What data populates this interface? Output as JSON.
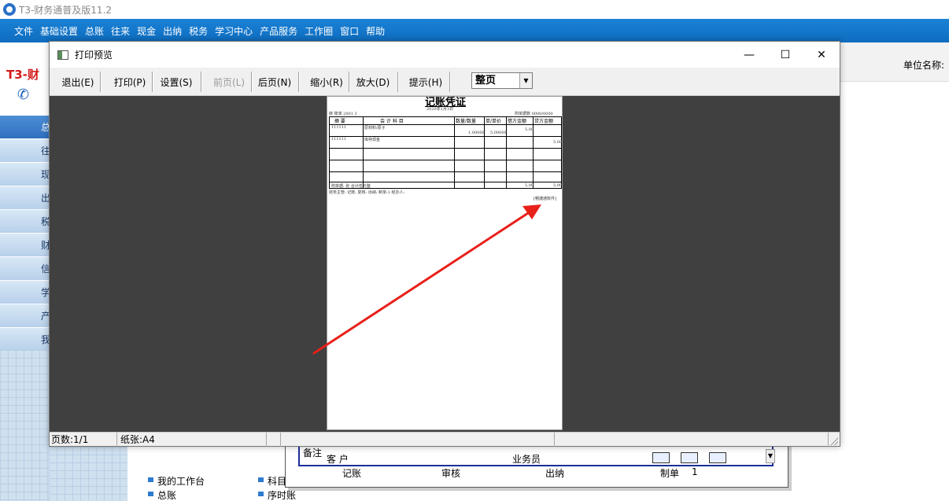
{
  "app": {
    "title": "T3-财务通普及版11.2",
    "brand": "T3-财",
    "menu": [
      "文件",
      "基础设置",
      "总账",
      "往来",
      "现金",
      "出纳",
      "税务",
      "学习中心",
      "产品服务",
      "工作圈",
      "窗口",
      "帮助"
    ],
    "left_nav": [
      "总",
      "往",
      "现",
      "出",
      "税",
      "财",
      "信",
      "学",
      "产",
      "我"
    ],
    "unit_label": "单位名称:",
    "bottom_links": [
      "我的工作台",
      "科目",
      "总账",
      "序时账"
    ]
  },
  "voucher_bg": {
    "labels": [
      "备注",
      "客  户",
      "业务员",
      "记账",
      "审核",
      "出纳",
      "制单",
      "1"
    ]
  },
  "dialog": {
    "title": "打印预览",
    "toolbar": {
      "exit": "退出(E)",
      "print": "打印(P)",
      "settings": "设置(S)",
      "prev": "前页(L)",
      "next": "后页(N)",
      "zoom_out": "缩小(R)",
      "zoom_in": "放大(D)",
      "hint": "提示(H)",
      "zoom_value": "整页"
    },
    "paper": {
      "title": "记账凭证",
      "date": "2020年1月3日",
      "left_header": "转 账单 2001 3",
      "right_header": "附单据数  0000/0000",
      "col_headers": [
        "摘    要",
        "会  计  科  目",
        "数量/数量",
        "单/单价",
        "借方金额",
        "贷方金额"
      ],
      "rows": [
        {
          "code": "111111",
          "account": "原材料/原子",
          "qty": "1.00000",
          "price": "5.00000",
          "debit": "5.00",
          "credit": ""
        },
        {
          "code": "111111",
          "account": "库存现金",
          "qty": "",
          "price": "",
          "debit": "",
          "credit": "5.00"
        }
      ],
      "total_label": "附单据:    张 合计伍元整",
      "total_debit": "5.00",
      "total_credit": "5.00",
      "footer": "财务主管:    记账:    复核:    出纳:    制单:1    经办人:",
      "stamp": "[畅捷通软件]"
    },
    "status": {
      "pages": "页数:1/1",
      "paper": "纸张:A4"
    }
  }
}
